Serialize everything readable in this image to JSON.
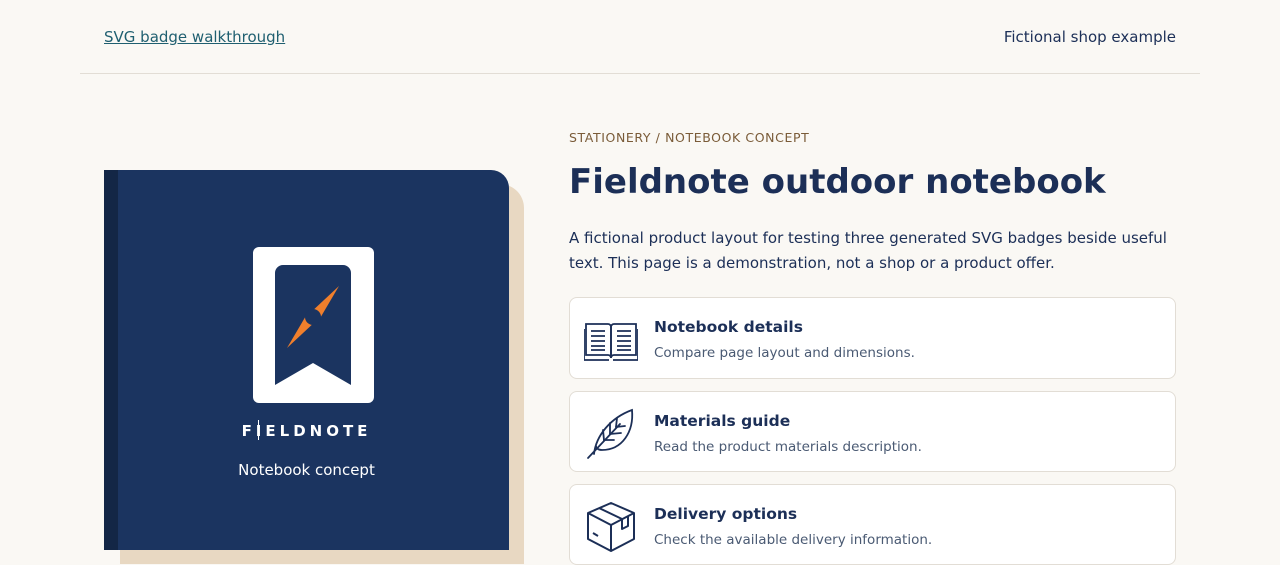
{
  "header": {
    "link_label": "SVG badge walkthrough",
    "right_label": "Fictional shop example"
  },
  "cover": {
    "brand": "FIELDNOTE",
    "tagline": "Notebook concept",
    "logo_icon": "compass-bookmark-icon"
  },
  "product": {
    "eyebrow": "STATIONERY / NOTEBOOK CONCEPT",
    "title": "Fieldnote outdoor notebook",
    "description": "A fictional product layout for testing three generated SVG badges beside useful text. This page is a demonstration, not a shop or a product offer."
  },
  "cards": [
    {
      "title": "Notebook details",
      "subtitle": "Compare page layout and dimensions.",
      "icon": "open-book-icon"
    },
    {
      "title": "Materials guide",
      "subtitle": "Read the product materials description.",
      "icon": "leaf-icon"
    },
    {
      "title": "Delivery options",
      "subtitle": "Check the available delivery information.",
      "icon": "package-box-icon"
    }
  ],
  "colors": {
    "background": "#faf8f4",
    "navy": "#1b3460",
    "accent_orange": "#f07f2c",
    "cover_edge": "#e8d8c2"
  }
}
